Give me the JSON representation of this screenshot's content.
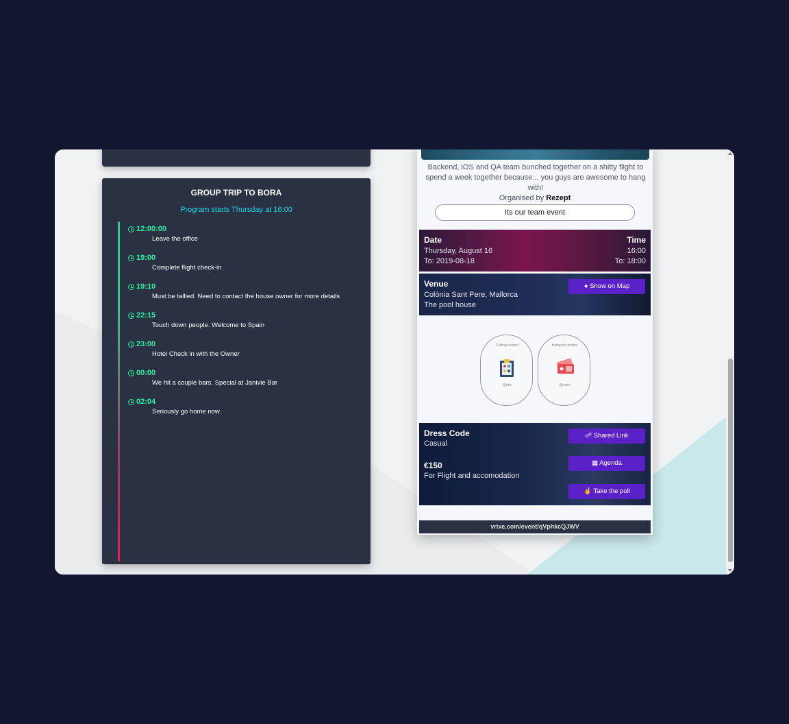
{
  "agenda": {
    "title": "GROUP TRIP TO BORA",
    "subtitle": "Program starts Thursday at 16:00",
    "items": [
      {
        "time": "12:00:00",
        "desc": "Leave the office"
      },
      {
        "time": "19:00",
        "desc": "Complete flight check-in"
      },
      {
        "time": "19:10",
        "desc": "Must be tallied. Need to contact the house owner for more details"
      },
      {
        "time": "22:15",
        "desc": "Touch down people. Welcome to Spain"
      },
      {
        "time": "23:00",
        "desc": "Hotel Check in with the Owner"
      },
      {
        "time": "00:00",
        "desc": "We hit a couple bars. Special at Janivie Bar"
      },
      {
        "time": "02:04",
        "desc": "Seriously go home now."
      }
    ]
  },
  "event": {
    "description": "Backend, iOS and QA team bunched together on a shitty flight to spend a week together because... you guys are awesome to hang with!",
    "organised_prefix": "Organised by",
    "organiser": "Rezept",
    "tag": "Its our team event",
    "date": {
      "heading": "Date",
      "line1": "Thursday, August 16",
      "line2": "To: 2019-08-18"
    },
    "time": {
      "heading": "Time",
      "line1": "16:00",
      "line2": "To: 18:00"
    },
    "venue": {
      "heading": "Venue",
      "line1": "Colònia Sant Pere, Mallorca",
      "line2": "The pool house",
      "map_button": "Show on Map"
    },
    "contacts": [
      {
        "label": "Coding contact",
        "handle": "@rick",
        "icon": "clipboard-icon"
      },
      {
        "label": "transport contact",
        "handle": "@mara",
        "icon": "ticket-icon"
      }
    ],
    "dress": {
      "heading": "Dress Code",
      "value": "Casual"
    },
    "price": {
      "heading": "€150",
      "value": "For Flight and accomodation"
    },
    "buttons": {
      "shared_link": "Shared Link",
      "agenda": "Agenda",
      "poll": "Take the poll"
    },
    "footer_url": "vrixe.com/event/qVphkcQJWV"
  },
  "colors": {
    "page_bg": "#121630",
    "panel": "#2a3142",
    "accent_button": "#5b21c8",
    "timeline_time": "#1ff5a1",
    "subtitle": "#18d3ea"
  }
}
